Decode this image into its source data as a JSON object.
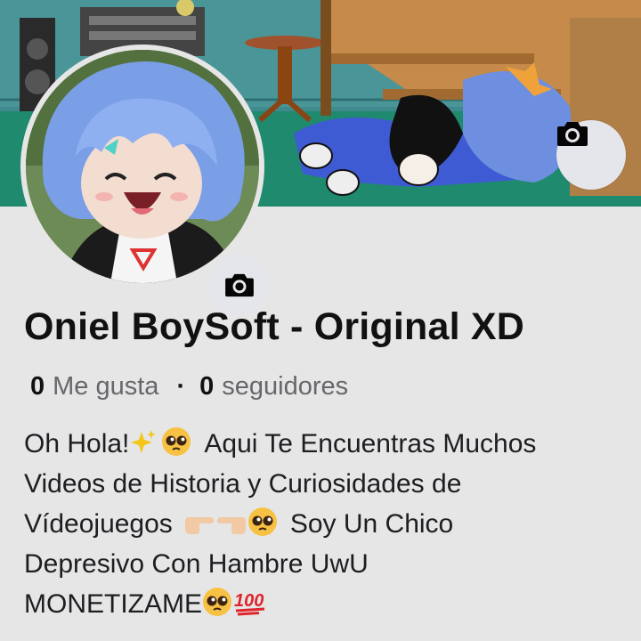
{
  "cover": {
    "camera_icon": "camera-icon",
    "palette": {
      "wall": "#3f8a8c",
      "floor": "#1f8a6e",
      "stairs": "#b88240"
    }
  },
  "avatar": {
    "camera_icon": "camera-icon",
    "palette": {
      "hair": "#7a9fe6",
      "skin": "#f3dcd0",
      "jacket": "#1b1b1b"
    }
  },
  "page": {
    "name": "Oniel BoySoft - Original XD"
  },
  "stats": {
    "likes_count": "0",
    "likes_label": "Me gusta",
    "separator": "·",
    "followers_count": "0",
    "followers_label": "seguidores"
  },
  "bio": {
    "line1_a": "Oh Hola!",
    "line1_b": "Aqui Te Encuentras Muchos",
    "line2": "Videos de Historia y Curiosidades de",
    "line3_a": "Vídeojuegos",
    "line3_b": "Soy Un Chico",
    "line4": "Depresivo Con Hambre UwU",
    "line5": "MONETIZAME",
    "emojis": [
      "sparkles",
      "pleading-face",
      "pointing-right",
      "pointing-left",
      "pleading-face",
      "pleading-face",
      "hundred-points"
    ]
  }
}
